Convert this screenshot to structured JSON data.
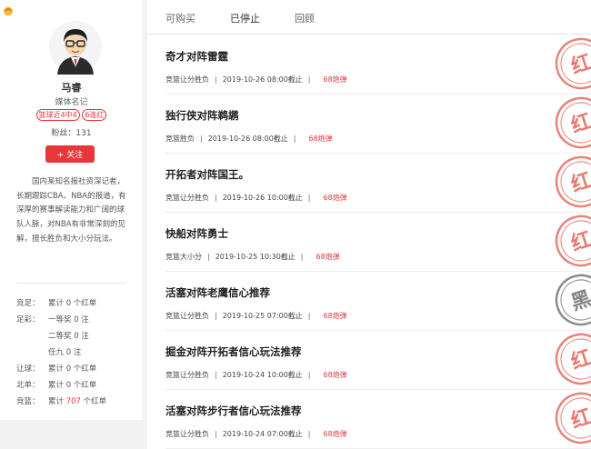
{
  "profile": {
    "name": "马睿",
    "title": "媒体名记",
    "badges": [
      "篮球近4中4",
      "6连红"
    ],
    "fans_label": "粉丝：",
    "fans_count": "131",
    "follow_label": "+ 关注",
    "bio": "国内某知名报社资深记者，长期跟踪CBA、NBA的报道，有深厚的赛事解读能力和广阔的球队人脉，对NBA有非常深刻的见解，擅长胜负和大小分玩法。",
    "stats": {
      "jingzu": {
        "key": "竞足：",
        "value": "累计 0 个红单"
      },
      "zucai": {
        "key": "足彩：",
        "r1": "一等奖 0 注",
        "r2": "二等奖 0 注",
        "r3": "任九 0 注"
      },
      "rangqiu": {
        "key": "让球：",
        "value": "累计 0 个红单"
      },
      "beidan": {
        "key": "北单：",
        "value": "累计 0 个红单"
      },
      "jinglan": {
        "key": "竞篮：",
        "pre": "累计 ",
        "num": "707",
        "post": " 个红单"
      }
    }
  },
  "tabs": [
    "可购买",
    "已停止",
    "回顾"
  ],
  "active_tab": "已停止",
  "items": [
    {
      "title": "奇才对阵雷霆",
      "type": "竞篮让分胜负",
      "time": "2019-10-26 08:00截止",
      "price": "68炮弹",
      "stamp": "红",
      "stamp_color": "#e25a4e"
    },
    {
      "title": "独行侠对阵鹈鹕",
      "type": "竞篮胜负",
      "time": "2019-10-26 08:00截止",
      "price": "68炮弹",
      "stamp": "红",
      "stamp_color": "#e25a4e"
    },
    {
      "title": "开拓者对阵国王。",
      "type": "竞篮让分胜负",
      "time": "2019-10-26 10:00截止",
      "price": "68炮弹",
      "stamp": "红",
      "stamp_color": "#e25a4e"
    },
    {
      "title": "快船对阵勇士",
      "type": "竞篮大小分",
      "time": "2019-10-25 10:30截止",
      "price": "68炮弹",
      "stamp": "红",
      "stamp_color": "#e25a4e"
    },
    {
      "title": "活塞对阵老鹰信心推荐",
      "type": "竞篮让分胜负",
      "time": "2019-10-25 07:00截止",
      "price": "68炮弹",
      "stamp": "黑",
      "stamp_color": "#666666"
    },
    {
      "title": "掘金对阵开拓者信心玩法推荐",
      "type": "竞篮让分胜负",
      "time": "2019-10-24 10:00截止",
      "price": "68炮弹",
      "stamp": "红",
      "stamp_color": "#e25a4e"
    },
    {
      "title": "活塞对阵步行者信心玩法推荐",
      "type": "竞篮让分胜负",
      "time": "2019-10-24 07:00截止",
      "price": "68炮弹",
      "stamp": "红",
      "stamp_color": "#e25a4e"
    }
  ],
  "colors": {
    "accent": "#e8363b"
  }
}
